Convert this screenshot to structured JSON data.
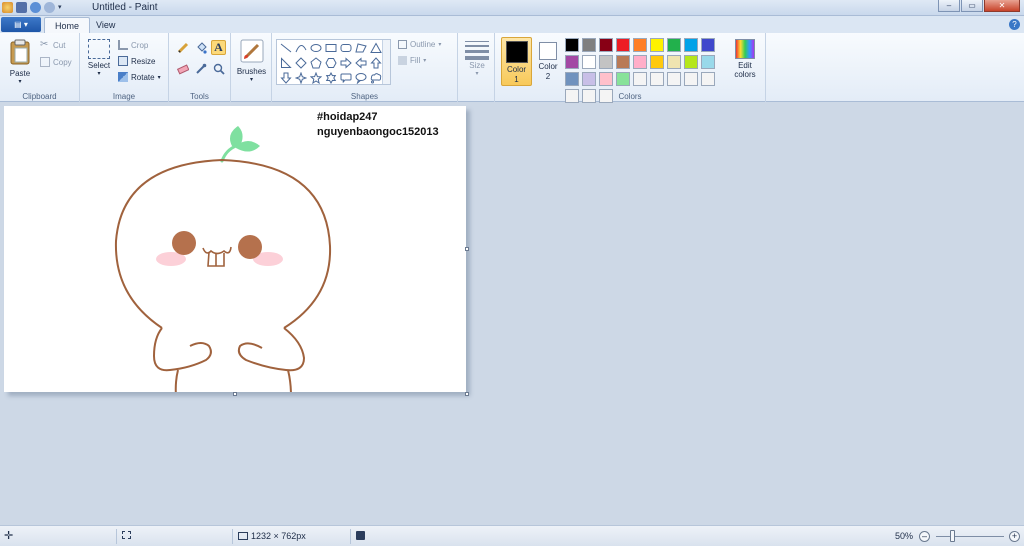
{
  "window": {
    "title": "Untitled - Paint",
    "controls": [
      "minimize",
      "maximize",
      "close"
    ]
  },
  "tabs": [
    {
      "label": "Home",
      "active": true
    },
    {
      "label": "View",
      "active": false
    }
  ],
  "ribbon": {
    "clipboard": {
      "group_label": "Clipboard",
      "paste": "Paste",
      "cut": "Cut",
      "copy": "Copy"
    },
    "image": {
      "group_label": "Image",
      "select": "Select",
      "crop": "Crop",
      "resize": "Resize",
      "rotate": "Rotate"
    },
    "tools": {
      "group_label": "Tools",
      "items": [
        "pencil-icon",
        "fill-icon",
        "text-icon",
        "eraser-icon",
        "color-picker-icon",
        "magnifier-icon"
      ]
    },
    "brushes": {
      "label": "Brushes"
    },
    "shapes": {
      "group_label": "Shapes",
      "outline": "Outline",
      "fill": "Fill"
    },
    "size": {
      "label": "Size"
    },
    "colors": {
      "group_label": "Colors",
      "color1_label": "Color 1",
      "color2_label": "Color 2",
      "edit_colors": "Edit colors",
      "color1": "#000000",
      "color2": "#ffffff",
      "palette": [
        "#000000",
        "#7f7f7f",
        "#880015",
        "#ed1c24",
        "#ff7f27",
        "#fff200",
        "#22b14c",
        "#00a2e8",
        "#3f48cc",
        "#a349a4",
        "#ffffff",
        "#c3c3c3",
        "#b97a57",
        "#ffaec9",
        "#ffc90e",
        "#efe4b0",
        "#b5e61d",
        "#99d9ea",
        "#7092be",
        "#c8bfe7",
        "#ffc0cb",
        "#88e29a",
        "#f4f4f4",
        "#f4f4f4",
        "#f4f4f4",
        "#f4f4f4",
        "#f4f4f4",
        "#f4f4f4",
        "#f4f4f4",
        "#f4f4f4"
      ]
    }
  },
  "canvas": {
    "text_line_1": "#hoidap247",
    "text_line_2": "nguyenbaongoc152013",
    "stroke_color": "#a0623d",
    "sprout_color": "#7fe0a0",
    "cheek_color": "#fcd0d8",
    "eye_color": "#b5714d"
  },
  "status": {
    "dimensions": "1232 × 762px",
    "zoom": "50%"
  }
}
